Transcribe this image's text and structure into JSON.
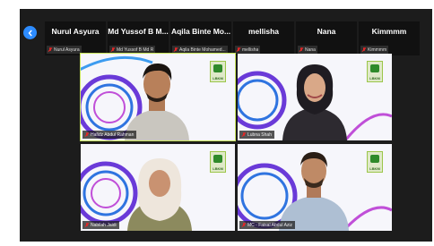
{
  "participants_strip": [
    {
      "display_name": "Nurul Asyura",
      "label": "Nurul Asyura"
    },
    {
      "display_name": "Md Yussof B M...",
      "label": "Md Yussof B Md R"
    },
    {
      "display_name": "Aqila Binte Mo...",
      "label": "Aqila Binte Mohamed..."
    },
    {
      "display_name": "mellisha",
      "label": "mellisha"
    },
    {
      "display_name": "Nana",
      "label": "Nana"
    },
    {
      "display_name": "Kimmmm",
      "label": "Kimmmm"
    }
  ],
  "video_tiles": [
    {
      "label": "Hafidz Abdul Rahman"
    },
    {
      "label": "Lubna Shah"
    },
    {
      "label": "Nabilah Jaidi"
    },
    {
      "label": "MC - Faisal Abdul Aziz"
    }
  ],
  "colors": {
    "accent_blue": "#2d8cff",
    "active_speaker": "#c8e35a",
    "muted_red": "#e02828"
  }
}
